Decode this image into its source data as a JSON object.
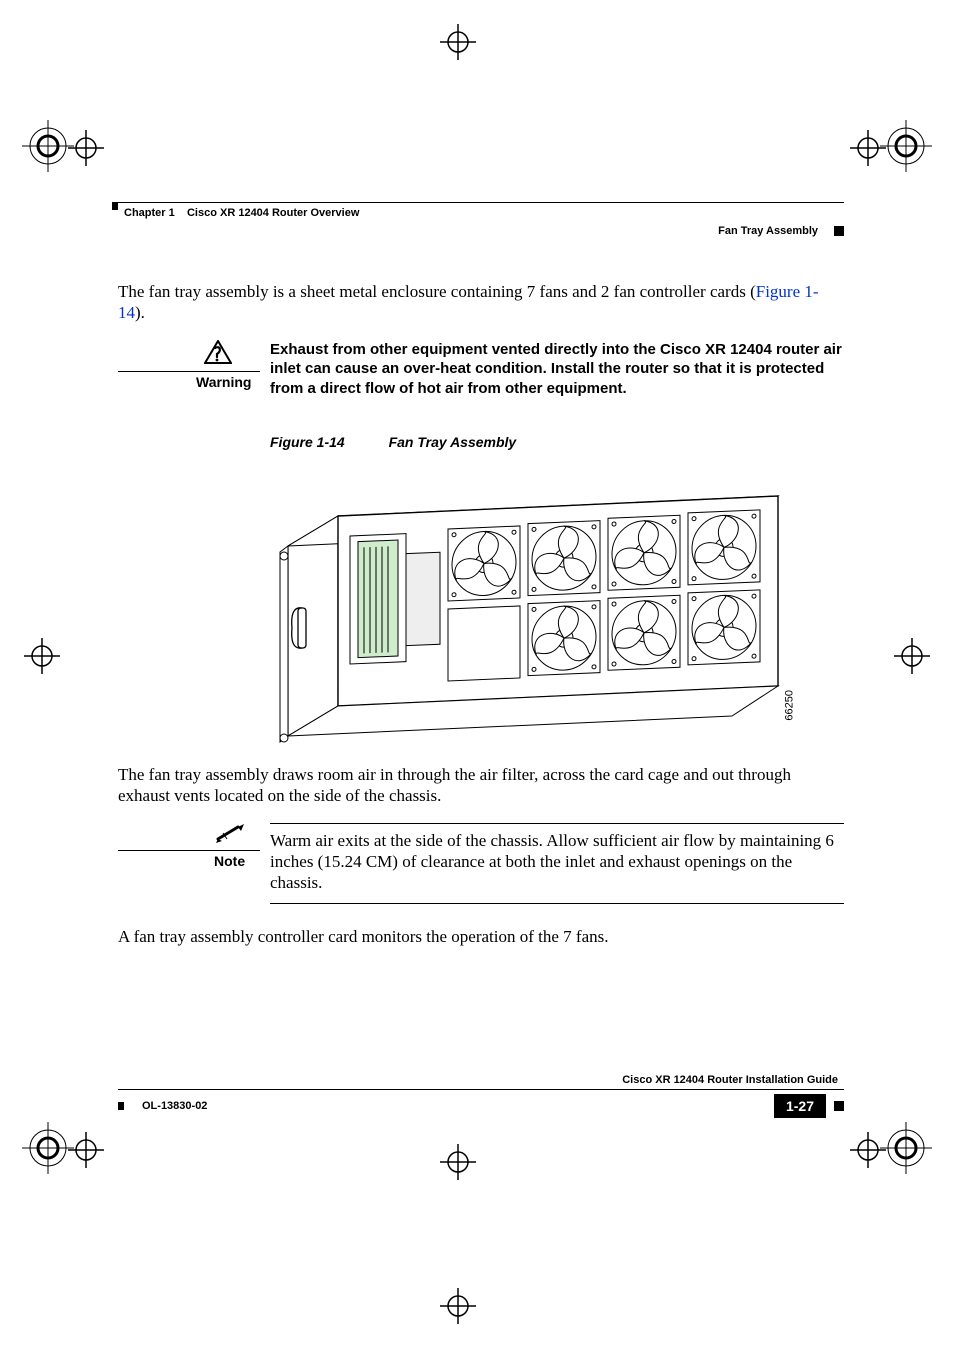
{
  "header": {
    "chapter": "Chapter 1",
    "chapter_title": "Cisco XR 12404 Router Overview",
    "section": "Fan Tray Assembly"
  },
  "intro_text_a": "The fan tray assembly is a sheet metal enclosure containing 7 fans and 2 fan controller cards (",
  "intro_link": "Figure 1-14",
  "intro_text_b": ").",
  "warning": {
    "label": "Warning",
    "text": "Exhaust from other equipment vented directly into the Cisco XR 12404 router air inlet can cause an over-heat condition. Install the router so that it is protected from a direct flow of hot air from other equipment."
  },
  "figure": {
    "number": "Figure 1-14",
    "title": "Fan Tray Assembly",
    "image_id": "66250"
  },
  "after_figure": "The fan tray assembly draws room air in through the air filter, across the card cage and out through exhaust vents located on the side of the chassis.",
  "note": {
    "label": "Note",
    "text": "Warm air exits at the side of the chassis. Allow sufficient air flow by maintaining 6 inches (15.24 CM) of clearance at both the inlet and exhaust openings on the chassis."
  },
  "closing": "A fan tray assembly controller card monitors the operation of the 7 fans.",
  "footer": {
    "guide": "Cisco XR 12404 Router Installation Guide",
    "docnum": "OL-13830-02",
    "page": "1-27"
  }
}
